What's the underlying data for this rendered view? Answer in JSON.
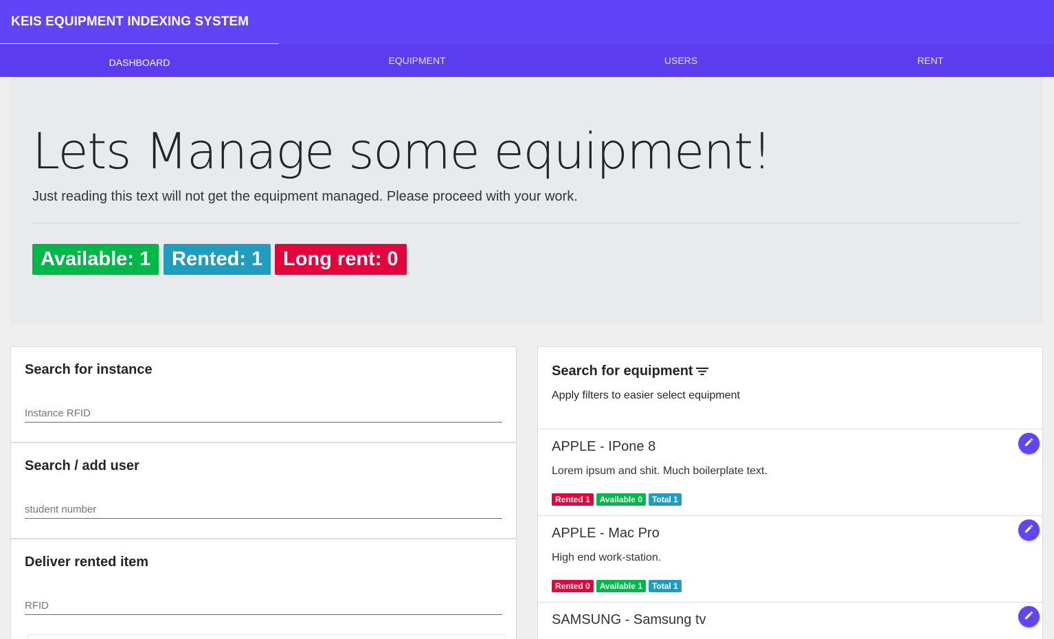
{
  "app": {
    "title": "KEIS EQUIPMENT INDEXING SYSTEM"
  },
  "tabs": [
    {
      "label": "DASHBOARD",
      "active": true
    },
    {
      "label": "EQUIPMENT",
      "active": false
    },
    {
      "label": "USERS",
      "active": false
    },
    {
      "label": "RENT",
      "active": false
    }
  ],
  "hero": {
    "title": "Lets Manage some equipment!",
    "lead": "Just reading this text will not get the equipment managed. Please proceed with your work.",
    "stats": {
      "available": "Available: 1",
      "rented": "Rented: 1",
      "long_rent": "Long rent: 0"
    }
  },
  "search_instance": {
    "title": "Search for instance",
    "placeholder": "Instance RFID"
  },
  "search_user": {
    "title": "Search / add user",
    "placeholder": "student number"
  },
  "deliver": {
    "title": "Deliver rented item",
    "placeholder": "RFID"
  },
  "equipment_search": {
    "title": "Search for equipment",
    "subtitle": "Apply filters to easier select equipment",
    "filter_icon": "filter-list-icon"
  },
  "equipment": [
    {
      "title": "APPLE - IPone 8",
      "description": "Lorem ipsum and shit. Much boilerplate text.",
      "rented": "Rented 1",
      "available": "Available 0",
      "total": "Total 1"
    },
    {
      "title": "APPLE - Mac Pro",
      "description": "High end work-station.",
      "rented": "Rented 0",
      "available": "Available 1",
      "total": "Total 1"
    },
    {
      "title": "SAMSUNG - Samsung tv"
    }
  ],
  "colors": {
    "primary": "#6244f8",
    "available": "#00b74a",
    "rented": "#1e9dbf",
    "long_rent": "#e5033b"
  },
  "icons": {
    "edit": "pencil-icon"
  }
}
